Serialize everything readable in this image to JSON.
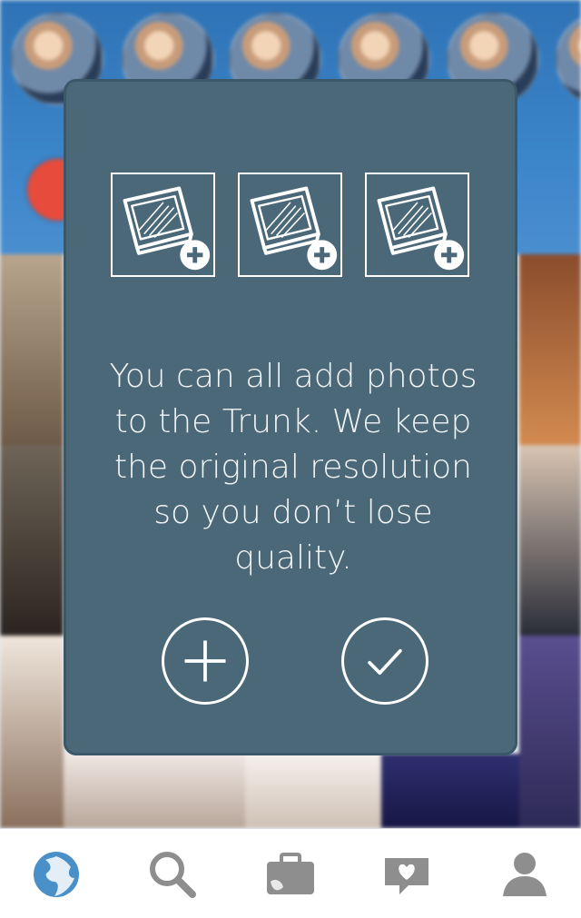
{
  "modal": {
    "message": "You can all add photos to the Trunk. We keep the original resolution so you don’t lose quality.",
    "icons": [
      "photo-add-icon",
      "photo-add-icon",
      "photo-add-icon"
    ],
    "actions": [
      "plus-icon",
      "check-icon"
    ]
  },
  "tabbar": {
    "tabs": [
      "globe-icon",
      "search-icon",
      "trunk-icon",
      "heart-chat-icon",
      "profile-icon"
    ],
    "active_tab": "globe-icon"
  },
  "colors": {
    "modal_bg": "#4b6878",
    "tab_active": "#4a90c8",
    "tab_inactive": "#8e8e8e",
    "cloud_button": "#e64b3c"
  }
}
